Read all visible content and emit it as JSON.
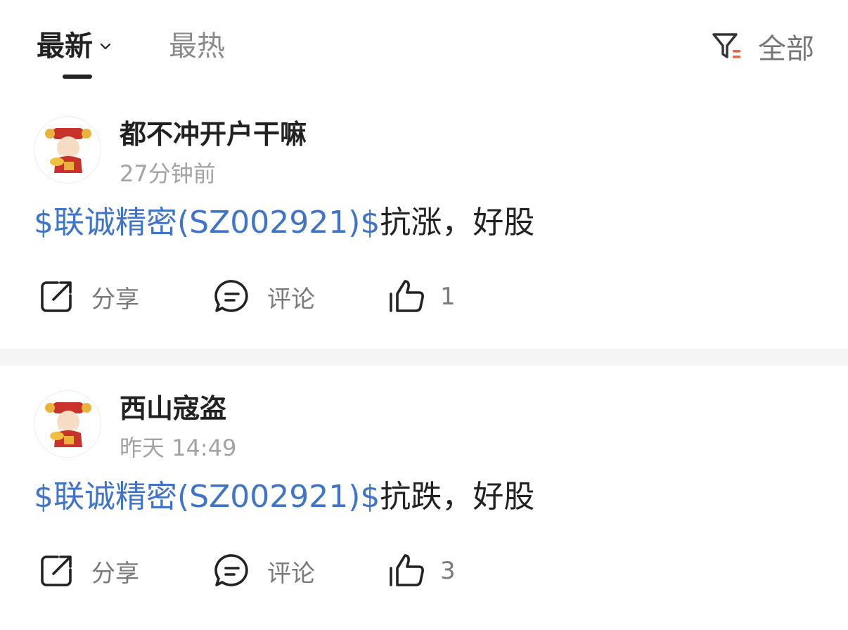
{
  "tabs": {
    "latest_label": "最新",
    "hot_label": "最热"
  },
  "filter": {
    "label": "全部",
    "icon": "filter-icon"
  },
  "colors": {
    "accent_link": "#3f74c9",
    "filter_dot": "#e8663a"
  },
  "posts": [
    {
      "username": "都不冲开户干嘛",
      "time": "27分钟前",
      "stock_tag": "$联诚精密(SZ002921)$",
      "text": "抗涨，好股",
      "share_label": "分享",
      "comment_label": "评论",
      "like_count": "1"
    },
    {
      "username": "西山寇盗",
      "time": "昨天 14:49",
      "stock_tag": "$联诚精密(SZ002921)$",
      "text": "抗跌，好股",
      "share_label": "分享",
      "comment_label": "评论",
      "like_count": "3"
    }
  ]
}
